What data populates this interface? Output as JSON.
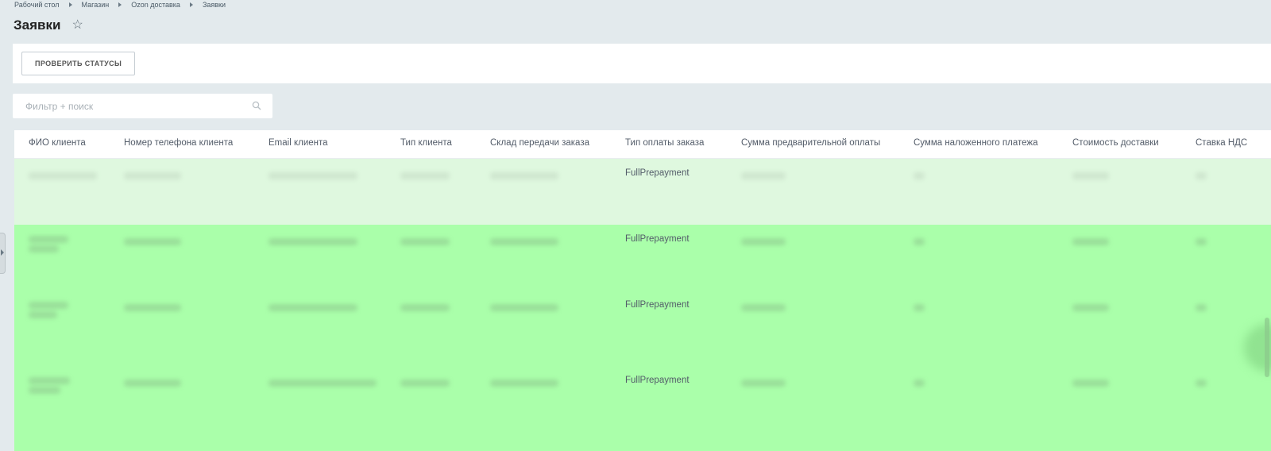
{
  "breadcrumb": {
    "items": [
      "Рабочий стол",
      "Магазин",
      "Ozon доставка",
      "Заявки"
    ]
  },
  "page": {
    "title": "Заявки",
    "favorite_icon": "star-icon"
  },
  "toolbar": {
    "check_statuses_label": "ПРОВЕРИТЬ СТАТУСЫ"
  },
  "filter": {
    "placeholder": "Фильтр + поиск",
    "value": "",
    "icon": "search-icon"
  },
  "grid": {
    "columns": [
      "ФИО клиента",
      "Номер телефона клиента",
      "Email клиента",
      "Тип клиента",
      "Склад передачи заказа",
      "Тип оплаты заказа",
      "Сумма предварительной оплаты",
      "Сумма наложенного платежа",
      "Стоимость доставки",
      "Ставка НДС"
    ],
    "rows": [
      {
        "payment_type": "FullPrepayment",
        "highlight": "#dff8df"
      },
      {
        "payment_type": "FullPrepayment",
        "highlight": "#aaffaa"
      },
      {
        "payment_type": "FullPrepayment",
        "highlight": "#aaffaa"
      },
      {
        "payment_type": "FullPrepayment",
        "highlight": "#aaffaa"
      }
    ]
  },
  "colors": {
    "background": "#e3eaed",
    "row_light_green": "#dff8df",
    "row_green": "#aaffaa"
  }
}
